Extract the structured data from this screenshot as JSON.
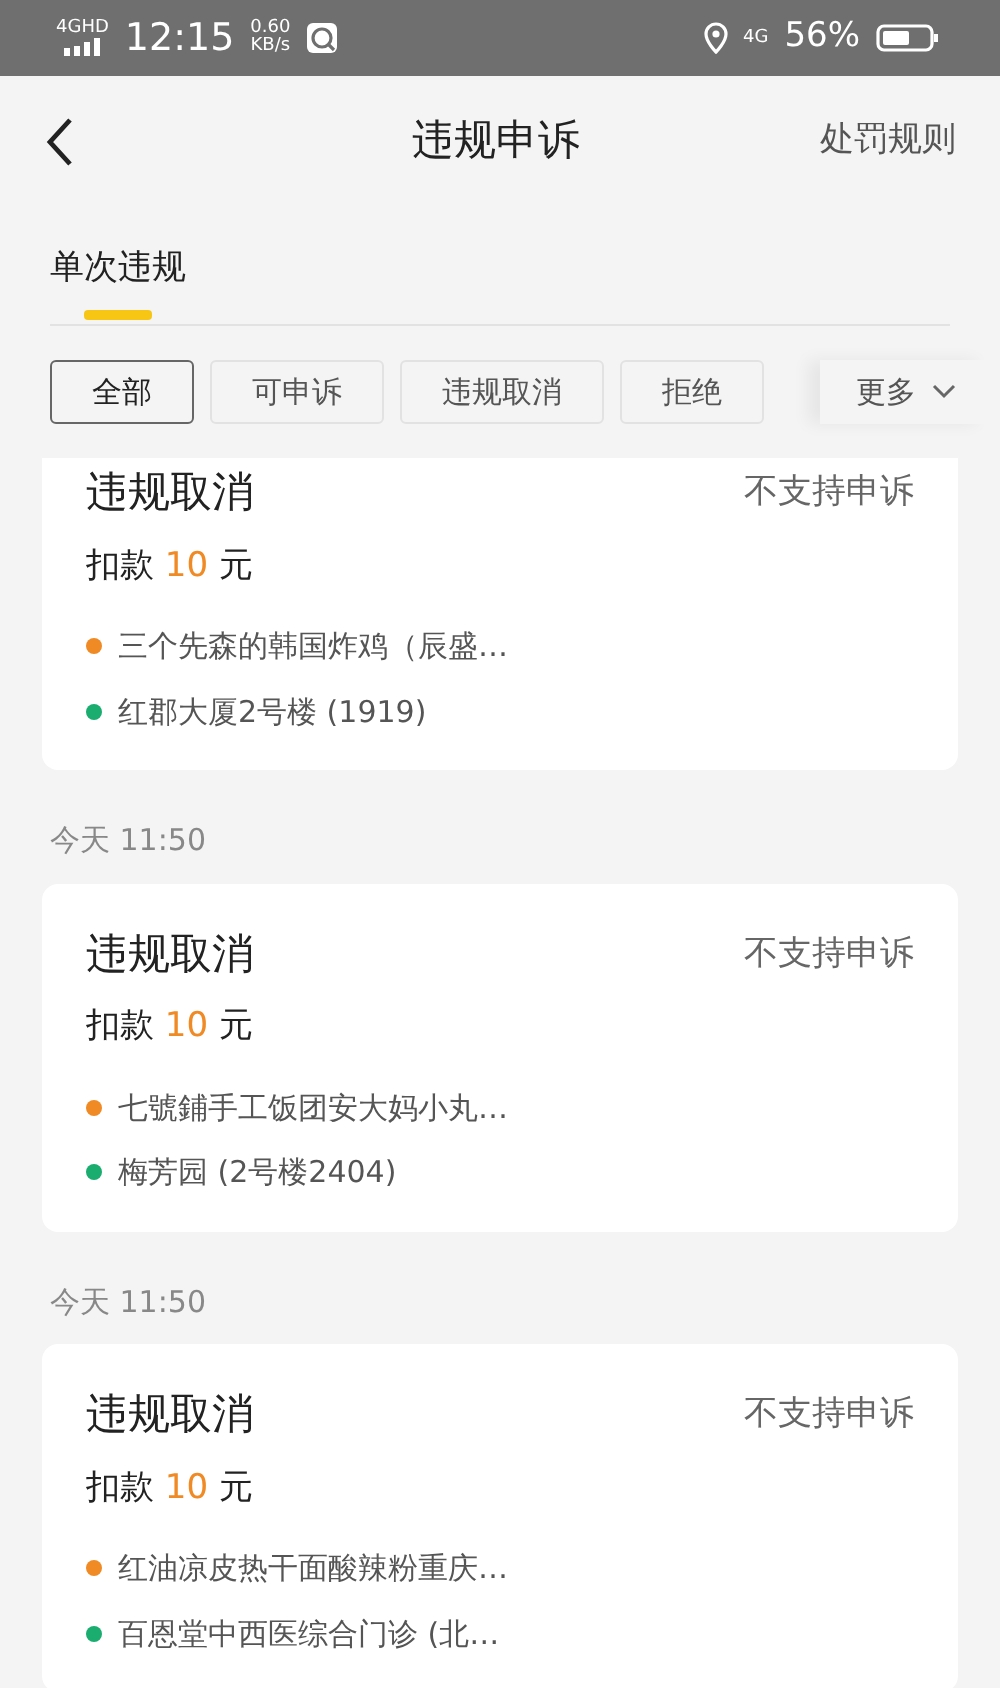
{
  "status_bar": {
    "network": "4GHD",
    "time": "12:15",
    "speed": "0.60",
    "speed_unit": "KB/s",
    "network_right": "4G",
    "battery": "56%"
  },
  "header": {
    "title": "违规申诉",
    "action": "处罚规则"
  },
  "tabs": [
    {
      "label": "单次违规",
      "selected": true
    }
  ],
  "filters": [
    {
      "label": "全部",
      "selected": true
    },
    {
      "label": "可申诉",
      "selected": false
    },
    {
      "label": "违规取消",
      "selected": false
    },
    {
      "label": "拒绝",
      "selected": false
    }
  ],
  "more": "更多",
  "records": [
    {
      "title": "违规取消",
      "appeal": "不支持申诉",
      "deduction": "扣款",
      "amount": "10",
      "unit": "元",
      "lines": [
        {
          "text": "三个先森的韩国炸鸡（辰盛…",
          "color": "#f08a24"
        },
        {
          "text": "红郡大厦2号楼 (1919)",
          "color": "#1aad6f"
        }
      ]
    },
    {
      "time": "今天 11:50",
      "title": "违规取消",
      "appeal": "不支持申诉",
      "deduction": "扣款",
      "amount": "10",
      "unit": "元",
      "lines": [
        {
          "text": "七號鋪手工饭团安大妈小丸…",
          "color": "#f08a24"
        },
        {
          "text": "梅芳园 (2号楼2404)",
          "color": "#1aad6f"
        }
      ]
    },
    {
      "time": "今天 11:50",
      "title": "违规取消",
      "appeal": "不支持申诉",
      "deduction": "扣款",
      "amount": "10",
      "unit": "元",
      "lines": [
        {
          "text": "红油凉皮热干面酸辣粉重庆…",
          "color": "#f08a24"
        },
        {
          "text": "百恩堂中西医综合门诊 (北…",
          "color": "#1aad6f"
        }
      ]
    }
  ]
}
